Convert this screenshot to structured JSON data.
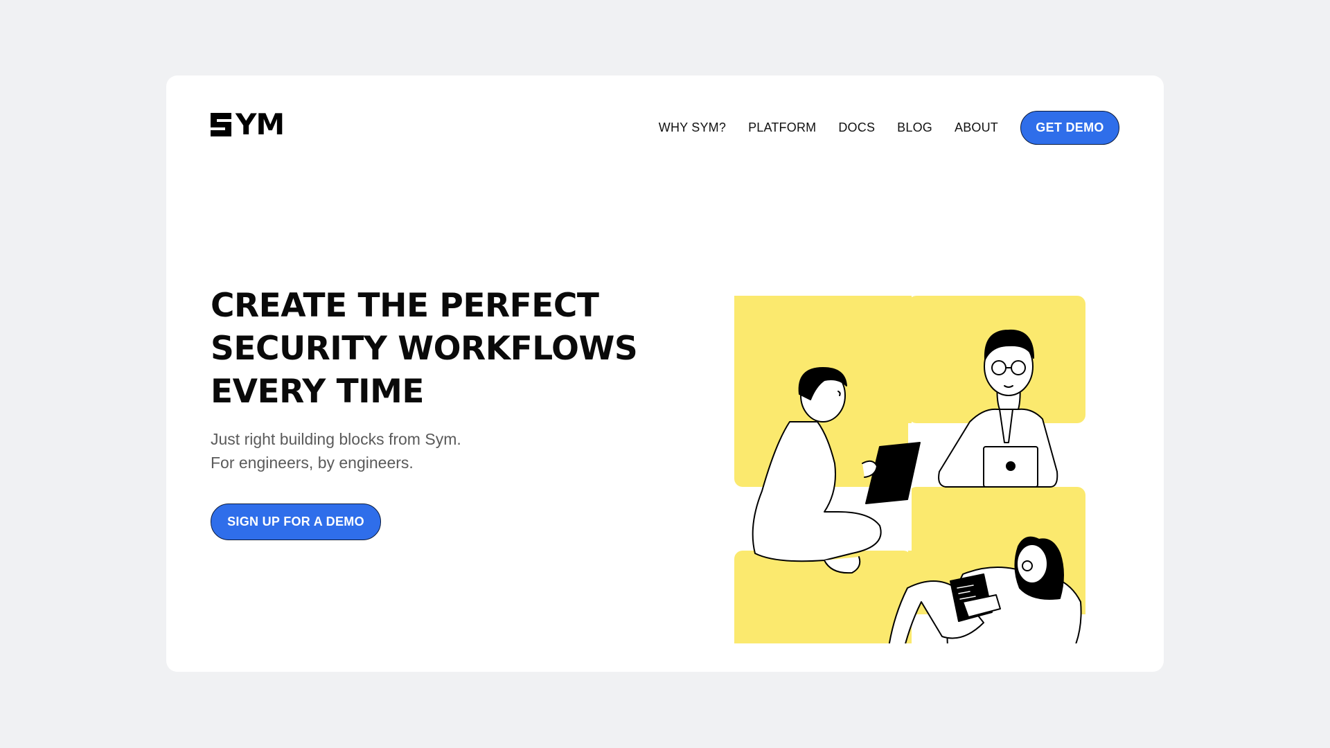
{
  "brand": {
    "name": "YM",
    "accent_color": "#2f6eea",
    "highlight_color": "#fbe96e"
  },
  "nav": {
    "items": [
      {
        "label": "WHY SYM?"
      },
      {
        "label": "PLATFORM"
      },
      {
        "label": "DOCS"
      },
      {
        "label": "BLOG"
      },
      {
        "label": "ABOUT"
      }
    ],
    "cta_label": "GET DEMO"
  },
  "hero": {
    "headline_lines": [
      "CREATE THE PERFECT",
      "SECURITY WORKFLOWS",
      "EVERY TIME"
    ],
    "sub_lines": [
      "Just right building blocks from Sym.",
      "For engineers, by engineers."
    ],
    "cta_label": "SIGN UP FOR A DEMO"
  },
  "illustration": {
    "icon": "people-working-illustration"
  }
}
